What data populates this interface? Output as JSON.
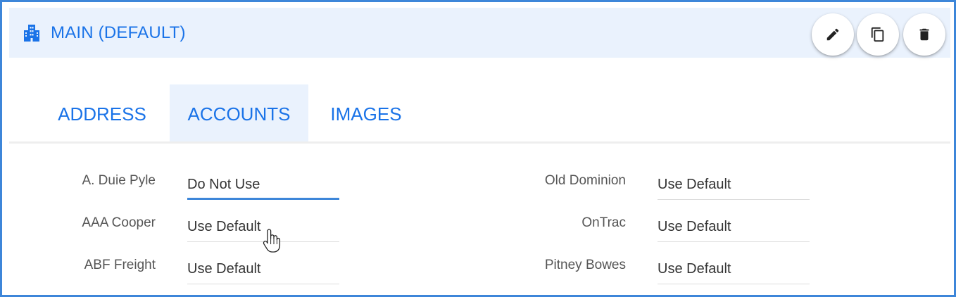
{
  "header": {
    "icon": "building-icon",
    "title": "MAIN (DEFAULT)",
    "actions": [
      {
        "icon": "pencil-icon",
        "name": "edit-button"
      },
      {
        "icon": "copy-icon",
        "name": "copy-button"
      },
      {
        "icon": "trash-icon",
        "name": "delete-button"
      }
    ]
  },
  "tabs": [
    {
      "label": "ADDRESS",
      "active": false
    },
    {
      "label": "ACCOUNTS",
      "active": true
    },
    {
      "label": "IMAGES",
      "active": false
    }
  ],
  "accounts": {
    "left": [
      {
        "carrier": "A. Duie Pyle",
        "value": "Do Not Use"
      },
      {
        "carrier": "AAA Cooper",
        "value": "Use Default"
      },
      {
        "carrier": "ABF Freight",
        "value": "Use Default"
      }
    ],
    "right": [
      {
        "carrier": "Old Dominion",
        "value": "Use Default"
      },
      {
        "carrier": "OnTrac",
        "value": "Use Default"
      },
      {
        "carrier": "Pitney Bowes",
        "value": "Use Default"
      }
    ]
  },
  "colors": {
    "accent": "#1a73e8",
    "header_bg": "#eaf2fd",
    "frame_border": "#3d86d9"
  }
}
